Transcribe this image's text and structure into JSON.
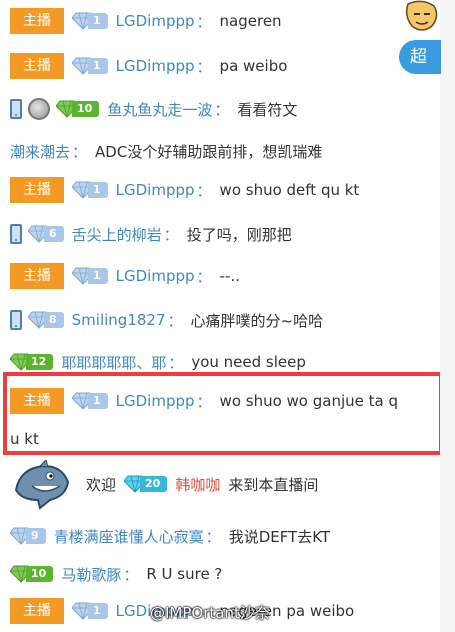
{
  "messages": [
    {
      "badge": "主播",
      "fan_level": "1",
      "fan_color": "blue",
      "user": "LGDimppp",
      "colon": "：",
      "text": "nageren"
    },
    {
      "badge": "主播",
      "fan_level": "1",
      "fan_color": "blue",
      "user": "LGDimppp",
      "colon": "：",
      "text": "pa weibo"
    },
    {
      "fan_level": "10",
      "fan_color": "green",
      "user": "鱼丸鱼丸走一波",
      "colon": "：",
      "text": "看看符文"
    },
    {
      "user": "潮来潮去",
      "colon": "：",
      "text": "ADC没个好辅助跟前排，想凯瑞难"
    },
    {
      "badge": "主播",
      "fan_level": "1",
      "fan_color": "blue",
      "user": "LGDimppp",
      "colon": "：",
      "text": "wo shuo deft qu kt"
    },
    {
      "fan_level": "6",
      "fan_color": "blue",
      "user": "舌尖上的柳岩",
      "colon": "：",
      "text": "投了吗，刚那把"
    },
    {
      "badge": "主播",
      "fan_level": "1",
      "fan_color": "blue",
      "user": "LGDimppp",
      "colon": "：",
      "text": "--.."
    },
    {
      "fan_level": "8",
      "fan_color": "blue",
      "user": "Smiling1827",
      "colon": "：",
      "text": "心痛胖噗的分~哈哈"
    },
    {
      "fan_level": "12",
      "fan_color": "green",
      "user": "耶耶耶耶耶、耶",
      "colon": "：",
      "text": "you need sleep"
    },
    {
      "badge": "主播",
      "fan_level": "1",
      "fan_color": "blue",
      "user": "LGDimppp",
      "colon": "：",
      "text": "wo shuo wo ganjue ta q",
      "wrap": "u kt"
    },
    {
      "welcome_prefix": "欢迎",
      "fan_level": "20",
      "fan_color": "cyan",
      "user": "韩咖咖",
      "welcome_suffix": "来到本直播间"
    },
    {
      "fan_level": "9",
      "fan_color": "blue",
      "user": "青楼满座谁懂人心寂寞",
      "colon": "：",
      "text": "我说DEFT去KT"
    },
    {
      "fan_level": "10",
      "fan_color": "green",
      "user": "马勒歌豚",
      "colon": "：",
      "text": "R U sure ?"
    },
    {
      "badge": "主播",
      "fan_level": "1",
      "fan_color": "blue",
      "user": "LGDimppp",
      "colon": "：",
      "text": "nageren pa weibo"
    }
  ],
  "side_button": "超",
  "watermark": "@IMPOrtant沙奈",
  "colors": {
    "host_badge": "#f39a24",
    "username": "#3f88c5",
    "highlight": "#ef3c3c",
    "welcome_name": "#e04e3c"
  }
}
